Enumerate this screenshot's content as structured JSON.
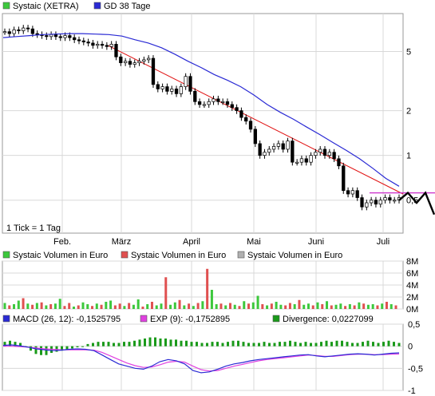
{
  "colors": {
    "candle_up": "#ffffff",
    "candle_down": "#000000",
    "gd_line": "#2a2ad4",
    "trend_line": "#e01010",
    "resistance_line": "#cc33cc",
    "projection": "#000000",
    "vol_up": "#3cc83c",
    "vol_down": "#e05050",
    "macd": "#2a2ad4",
    "exp": "#e040e0",
    "divergence": "#1a9a1a",
    "grid": "#d8d8d8",
    "frame": "#9a9a9a"
  },
  "price_panel": {
    "legend": [
      {
        "label": "Systaic (XETRA)",
        "swatch": "#3cc83c"
      },
      {
        "label": "GD 38 Tage",
        "swatch": "#2a2ad4"
      }
    ],
    "tick_note": "1 Tick = 1 Tag",
    "months": [
      "Feb.",
      "März",
      "April",
      "Mai",
      "Juni",
      "Juli"
    ],
    "y_ticks": [
      "5",
      "2",
      "1",
      "0,5"
    ]
  },
  "volume_panel": {
    "legend": [
      {
        "label": "Systaic Volumen in Euro",
        "swatch": "#3cc83c"
      },
      {
        "label": "Systaic Volumen in Euro",
        "swatch": "#e05050"
      },
      {
        "label": "Systaic Volumen in Euro",
        "swatch": "#b0b0b0"
      }
    ],
    "y_ticks": [
      "8M",
      "6M",
      "4M",
      "2M",
      "0M"
    ]
  },
  "macd_panel": {
    "legend": [
      {
        "label": "MACD (26, 12): -0,1525795",
        "swatch": "#2a2ad4"
      },
      {
        "label": "EXP (9): -0,1752895",
        "swatch": "#e040e0"
      },
      {
        "label": "Divergence: 0,0227099",
        "swatch": "#1a9a1a"
      }
    ],
    "y_ticks": [
      "0,5",
      "0",
      "-0,5",
      "-1"
    ]
  },
  "chart_data": [
    {
      "type": "line",
      "title": "Systaic (XETRA)",
      "y_scale": "log",
      "ylim": [
        0.3,
        9
      ],
      "x_range": [
        "Jan",
        "Jul"
      ],
      "series": [
        {
          "name": "Systaic (XETRA)",
          "values": [
            6.8,
            6.6,
            7.0,
            6.9,
            7.2,
            7.1,
            6.6,
            6.5,
            6.4,
            6.3,
            6.5,
            6.3,
            6.2,
            6.4,
            6.2,
            6.0,
            5.9,
            5.8,
            5.7,
            5.5,
            5.6,
            5.5,
            5.4,
            5.6,
            4.6,
            4.2,
            4.3,
            4.1,
            4.2,
            4.3,
            4.4,
            4.5,
            3.0,
            2.8,
            2.9,
            2.7,
            2.8,
            2.6,
            2.9,
            3.4,
            2.7,
            2.3,
            2.2,
            2.2,
            2.3,
            2.4,
            2.3,
            2.3,
            2.2,
            2.1,
            2.0,
            1.8,
            1.7,
            1.5,
            1.2,
            1.0,
            1.05,
            1.1,
            1.15,
            1.2,
            1.1,
            1.25,
            0.9,
            0.9,
            0.95,
            0.9,
            1.0,
            1.05,
            1.1,
            1.0,
            1.05,
            0.95,
            0.85,
            0.58,
            0.55,
            0.58,
            0.52,
            0.45,
            0.48,
            0.5,
            0.47,
            0.5,
            0.52,
            0.5,
            0.5,
            0.52
          ]
        },
        {
          "name": "GD 38 Tage",
          "values": [
            6.2,
            6.3,
            6.4,
            6.5,
            6.55,
            6.6,
            6.6,
            6.55,
            6.5,
            6.35,
            6.0,
            5.7,
            5.3,
            4.8,
            4.3,
            3.9,
            3.5,
            3.2,
            2.9,
            2.55,
            2.2,
            1.95,
            1.75,
            1.55,
            1.38,
            1.22,
            1.08,
            0.95,
            0.82,
            0.7,
            0.62
          ]
        }
      ],
      "projection": [
        0.5,
        0.56,
        0.48,
        0.56,
        0.4
      ]
    },
    {
      "type": "bar",
      "title": "Systaic Volumen in Euro",
      "ylim": [
        0,
        8000000
      ],
      "unit": "M",
      "values": [
        1.0,
        0.6,
        0.8,
        1.4,
        1.8,
        0.9,
        0.7,
        1.0,
        1.1,
        0.6,
        0.8,
        0.9,
        1.7,
        0.5,
        1.0,
        0.4,
        0.6,
        1.1,
        0.8,
        0.5,
        0.9,
        0.7,
        1.2,
        1.4,
        0.6,
        0.9,
        0.5,
        1.0,
        0.7,
        1.6,
        0.4,
        0.8,
        1.2,
        0.6,
        0.9,
        5.3,
        0.7,
        1.1,
        1.5,
        0.6,
        0.9,
        0.5,
        1.0,
        1.3,
        6.7,
        3.2,
        0.8,
        0.9,
        0.6,
        1.0,
        0.7,
        0.5,
        1.3,
        0.9,
        1.1,
        2.2,
        0.8,
        0.6,
        0.9,
        1.2,
        0.7,
        0.6,
        1.0,
        0.8,
        1.5,
        0.7,
        0.9,
        0.6,
        1.1,
        0.8,
        1.3,
        0.6,
        0.7,
        0.9,
        0.5,
        0.8,
        0.6,
        1.1,
        0.9,
        0.7,
        0.8,
        0.6,
        0.9,
        1.2,
        0.8,
        0.6
      ],
      "up": [
        1,
        0,
        1,
        1,
        0,
        1,
        0,
        1,
        0,
        1,
        0,
        1,
        1,
        0,
        0,
        1,
        0,
        1,
        1,
        0,
        1,
        0,
        1,
        1,
        0,
        0,
        1,
        0,
        1,
        1,
        0,
        1,
        0,
        1,
        1,
        0,
        1,
        1,
        0,
        1,
        0,
        1,
        0,
        1,
        0,
        1,
        1,
        0,
        1,
        0,
        1,
        0,
        1,
        0,
        1,
        1,
        0,
        1,
        0,
        1,
        1,
        0,
        0,
        1,
        0,
        1,
        1,
        0,
        1,
        0,
        1,
        0,
        1,
        1,
        0,
        1,
        0,
        1,
        0,
        1,
        1,
        0,
        1,
        0,
        1,
        0
      ]
    },
    {
      "type": "line",
      "title": "MACD",
      "ylim": [
        -1,
        0.5
      ],
      "series": [
        {
          "name": "MACD (26, 12)",
          "values": [
            0.02,
            0.03,
            0.01,
            -0.02,
            -0.06,
            -0.08,
            -0.1,
            -0.09,
            -0.07,
            -0.06,
            -0.07,
            -0.1,
            -0.2,
            -0.3,
            -0.4,
            -0.45,
            -0.5,
            -0.52,
            -0.45,
            -0.35,
            -0.3,
            -0.33,
            -0.4,
            -0.55,
            -0.6,
            -0.58,
            -0.52,
            -0.45,
            -0.4,
            -0.37,
            -0.33,
            -0.3,
            -0.28,
            -0.26,
            -0.24,
            -0.22,
            -0.2,
            -0.19,
            -0.22,
            -0.24,
            -0.22,
            -0.2,
            -0.18,
            -0.17,
            -0.18,
            -0.2,
            -0.18,
            -0.16,
            -0.15
          ]
        },
        {
          "name": "EXP (9)",
          "values": [
            0.0,
            0.0,
            -0.01,
            -0.02,
            -0.04,
            -0.06,
            -0.07,
            -0.08,
            -0.08,
            -0.08,
            -0.08,
            -0.09,
            -0.14,
            -0.22,
            -0.3,
            -0.38,
            -0.44,
            -0.48,
            -0.47,
            -0.42,
            -0.36,
            -0.34,
            -0.36,
            -0.45,
            -0.53,
            -0.56,
            -0.55,
            -0.5,
            -0.45,
            -0.41,
            -0.37,
            -0.33,
            -0.3,
            -0.28,
            -0.26,
            -0.24,
            -0.22,
            -0.2,
            -0.21,
            -0.23,
            -0.23,
            -0.21,
            -0.19,
            -0.18,
            -0.18,
            -0.19,
            -0.19,
            -0.18,
            -0.175
          ]
        }
      ],
      "divergence": [
        0.04,
        0.05,
        0.04,
        0.03,
        0.0,
        -0.04,
        -0.07,
        -0.08,
        -0.08,
        -0.06,
        -0.05,
        -0.04,
        -0.03,
        -0.02,
        -0.01,
        0.0,
        0.02,
        0.03,
        0.04,
        0.04,
        0.04,
        0.03,
        0.03,
        0.04,
        0.04,
        0.05,
        0.06,
        0.07,
        0.08,
        0.08,
        0.07,
        0.07,
        0.06,
        0.06,
        0.05,
        0.05,
        0.04,
        0.04,
        0.03,
        0.03,
        0.04,
        0.04,
        0.03,
        0.04,
        0.05,
        0.05,
        0.04,
        0.03,
        0.03,
        0.03,
        0.04,
        0.03,
        0.03,
        0.04,
        0.04,
        0.05,
        0.04,
        0.03,
        0.04,
        0.03,
        0.03,
        0.04,
        0.05,
        0.04,
        0.05,
        0.05,
        0.04,
        0.03,
        0.03,
        0.04,
        0.05,
        0.04,
        0.03,
        0.04,
        0.05,
        0.04,
        0.03
      ]
    }
  ]
}
